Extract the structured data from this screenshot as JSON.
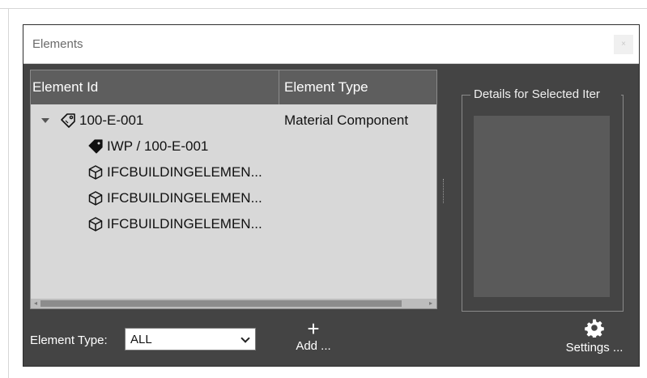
{
  "window": {
    "title": "Elements",
    "close_glyph": "×"
  },
  "table": {
    "columns": [
      "Element Id",
      "Element Type"
    ],
    "rows": [
      {
        "id": "100-E-001",
        "type": "Material Component",
        "icon": "tag-outline-icon",
        "expanded": true
      },
      {
        "id": "IWP / 100-E-001",
        "type": "",
        "icon": "tag-filled-icon"
      },
      {
        "id": "IFCBUILDINGELEMEN...",
        "type": "",
        "icon": "cube-icon"
      },
      {
        "id": "IFCBUILDINGELEMEN...",
        "type": "",
        "icon": "cube-icon"
      },
      {
        "id": "IFCBUILDINGELEMEN...",
        "type": "",
        "icon": "cube-icon"
      }
    ]
  },
  "details": {
    "legend": "Details for Selected Iter"
  },
  "filter": {
    "label": "Element Type:",
    "value": "ALL"
  },
  "toolbar": {
    "add_label": "Add ...",
    "add_glyph": "+",
    "settings_label": "Settings ...",
    "settings_icon": "gear-icon"
  },
  "colors": {
    "panel": "#444444",
    "tree_bg": "#d8d8d8",
    "header_bg": "#5e5e5e"
  }
}
